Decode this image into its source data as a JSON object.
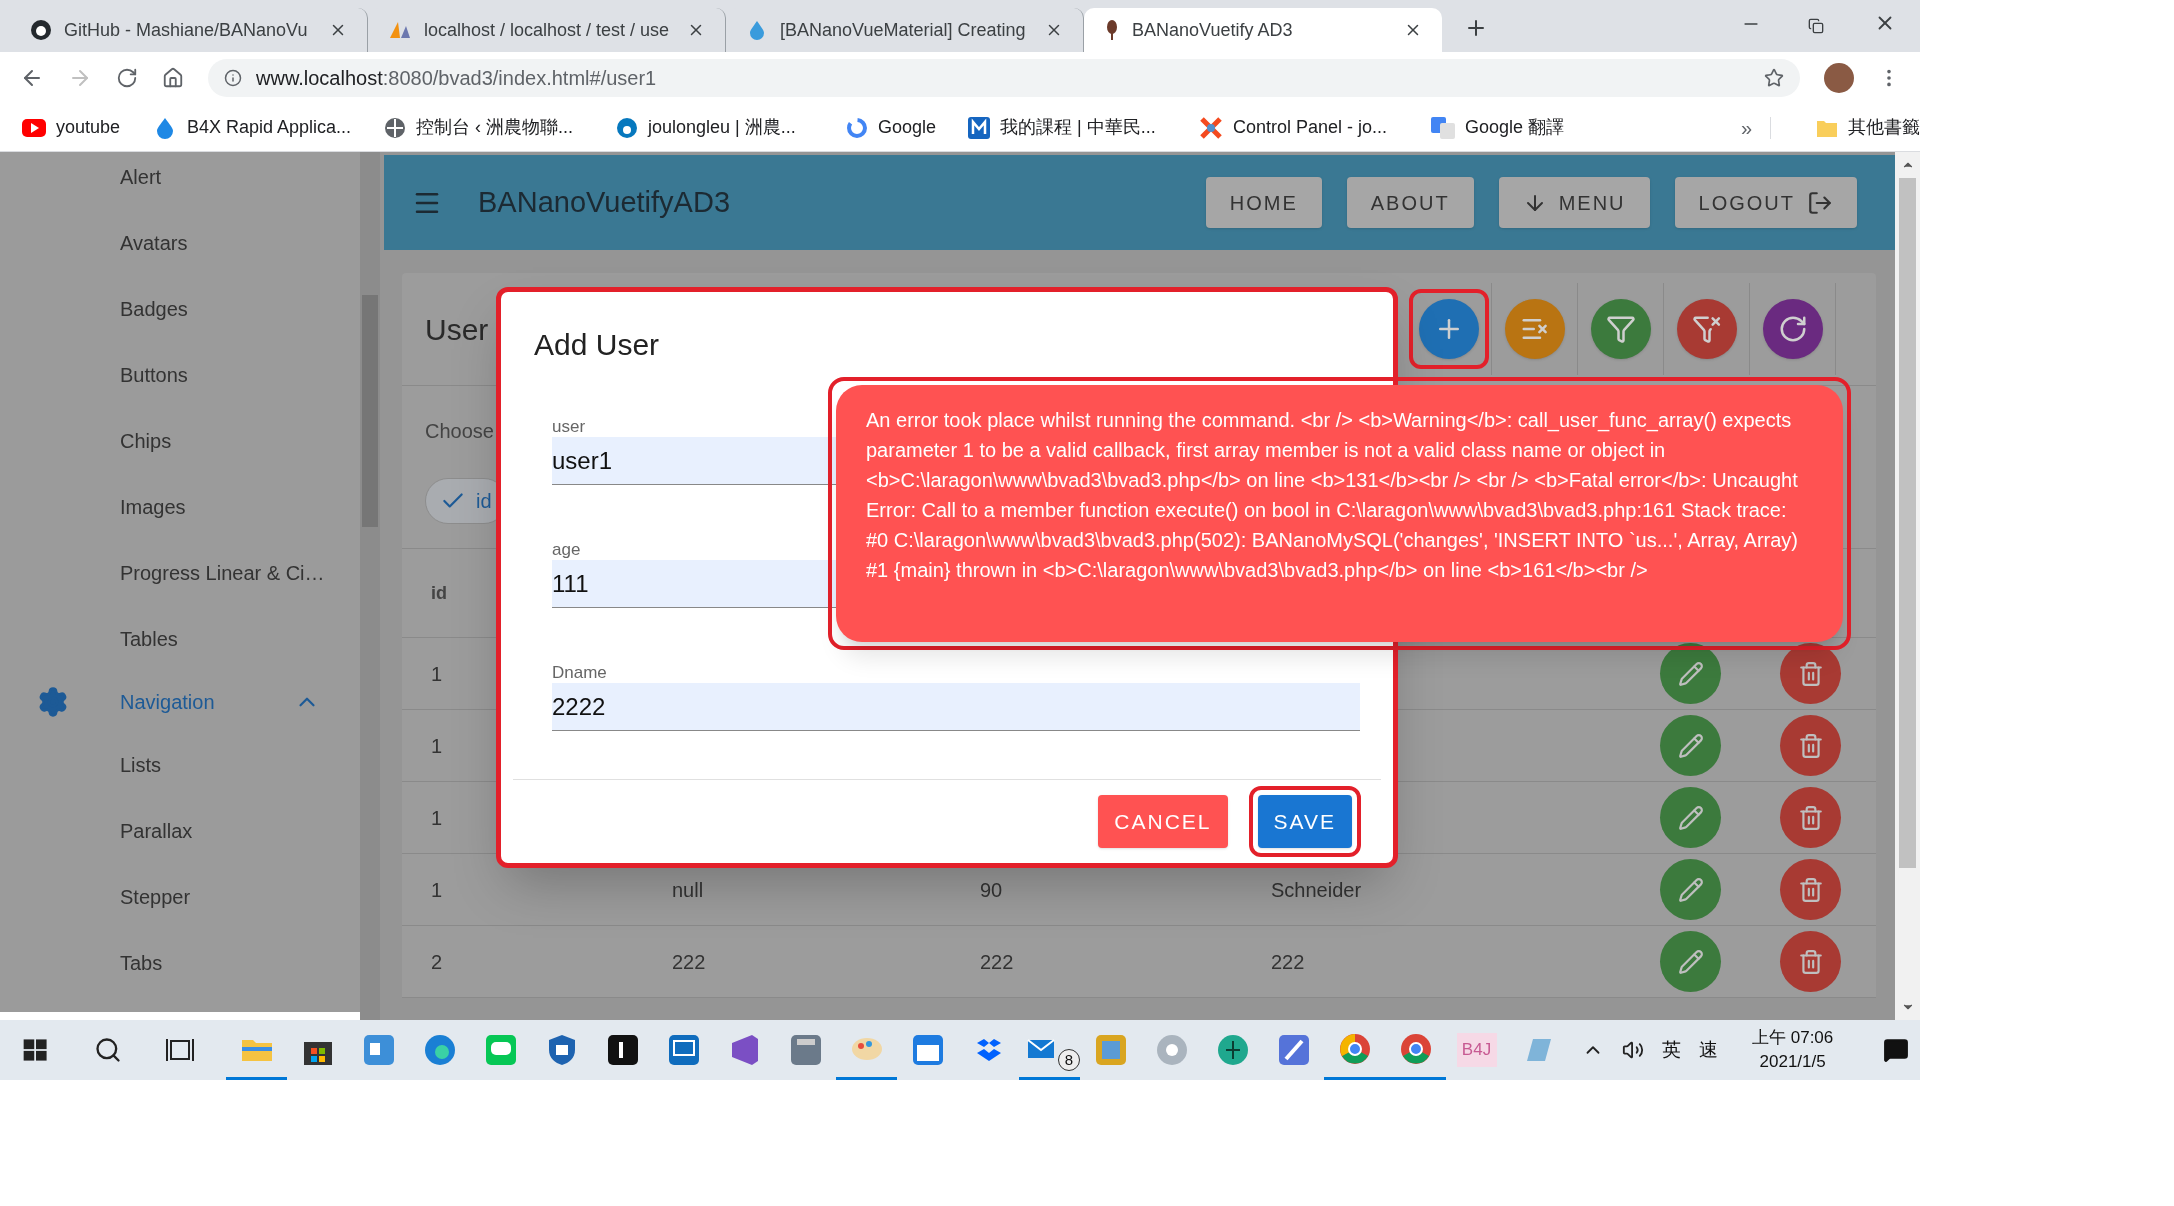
{
  "browser": {
    "tabs": [
      {
        "title": "GitHub - Mashiane/BANanoVu",
        "selected": false
      },
      {
        "title": "localhost / localhost / test / use",
        "selected": false
      },
      {
        "title": "[BANanoVueMaterial] Creating",
        "selected": false
      },
      {
        "title": "BANanoVuetify AD3",
        "selected": true
      }
    ],
    "address": {
      "host": "www.localhost",
      "path": ":8080/bvad3/index.html#/user1"
    },
    "bookmarks": [
      "youtube",
      "B4X Rapid Applica...",
      "控制台 ‹ 洲農物聯...",
      "joulongleu | 洲農...",
      "Google",
      "我的課程 | 中華民...",
      "Control Panel - jo...",
      "Google 翻譯"
    ],
    "overflow": "»",
    "other_bookmarks": "其他書籤"
  },
  "sidebar": {
    "items": [
      {
        "label": "Alert",
        "kind": "item"
      },
      {
        "label": "Avatars",
        "kind": "item"
      },
      {
        "label": "Badges",
        "kind": "item"
      },
      {
        "label": "Buttons",
        "kind": "item"
      },
      {
        "label": "Chips",
        "kind": "item"
      },
      {
        "label": "Images",
        "kind": "item"
      },
      {
        "label": "Progress Linear & Ci…",
        "kind": "item"
      },
      {
        "label": "Tables",
        "kind": "item"
      },
      {
        "label": "Navigation",
        "kind": "group",
        "expanded": true
      },
      {
        "label": "Lists",
        "kind": "item"
      },
      {
        "label": "Parallax",
        "kind": "item"
      },
      {
        "label": "Stepper",
        "kind": "item"
      },
      {
        "label": "Tabs",
        "kind": "item"
      }
    ]
  },
  "app_bar": {
    "title": "BANanoVuetifyAD3",
    "buttons": [
      {
        "label": "HOME",
        "kind": "plain"
      },
      {
        "label": "ABOUT",
        "kind": "plain"
      },
      {
        "label": "MENU",
        "kind": "menu"
      },
      {
        "label": "LOGOUT",
        "kind": "logout"
      }
    ]
  },
  "card": {
    "title": "User",
    "subtitle": "Choose",
    "chip": {
      "label": "id",
      "checked": true
    },
    "actions": [
      {
        "kind": "add",
        "annotated": true
      },
      {
        "kind": "clear-sort",
        "annotated": false
      },
      {
        "kind": "filter",
        "annotated": false
      },
      {
        "kind": "clear-filter",
        "annotated": false
      },
      {
        "kind": "refresh",
        "annotated": false
      }
    ],
    "columns": [
      "id"
    ],
    "rows": [
      {
        "cells": [
          "1"
        ]
      },
      {
        "cells": [
          "1"
        ]
      },
      {
        "cells": [
          "1"
        ]
      },
      {
        "cells": [
          "1",
          "null",
          "90",
          "Schneider"
        ]
      },
      {
        "cells": [
          "2",
          "222",
          "222",
          "222"
        ]
      }
    ]
  },
  "dialog": {
    "title": "Add User",
    "annotated": true,
    "fields": [
      {
        "label": "user",
        "value": "user1"
      },
      {
        "label": "age",
        "value": "111"
      },
      {
        "label": "Dname",
        "value": "2222"
      }
    ],
    "buttons": [
      {
        "label": "CANCEL",
        "kind": "cancel",
        "annotated": false
      },
      {
        "label": "SAVE",
        "kind": "save",
        "annotated": true
      }
    ]
  },
  "error_toast": {
    "annotated": true,
    "message": "An error took place whilst running the command. <br /> <b>Warning</b>: call_user_func_array() expects parameter 1 to be a valid callback, first array member is not a valid class name or object in <b>C:\\laragon\\www\\bvad3\\bvad3.php</b> on line <b>131</b><br /> <br /> <b>Fatal error</b>: Uncaught Error: Call to a member function execute() on bool in C:\\laragon\\www\\bvad3\\bvad3.php:161 Stack trace: #0 C:\\laragon\\www\\bvad3\\bvad3.php(502): BANanoMySQL('changes', 'INSERT INTO `us...', Array, Array) #1 {main} thrown in <b>C:\\laragon\\www\\bvad3\\bvad3.php</b> on line <b>161</b><br />"
  },
  "taskbar": {
    "mail_badge": "8",
    "b4j_label": "B4J",
    "tray": [
      "英",
      "速"
    ],
    "time": "上午 07:06",
    "date": "2021/1/5"
  }
}
